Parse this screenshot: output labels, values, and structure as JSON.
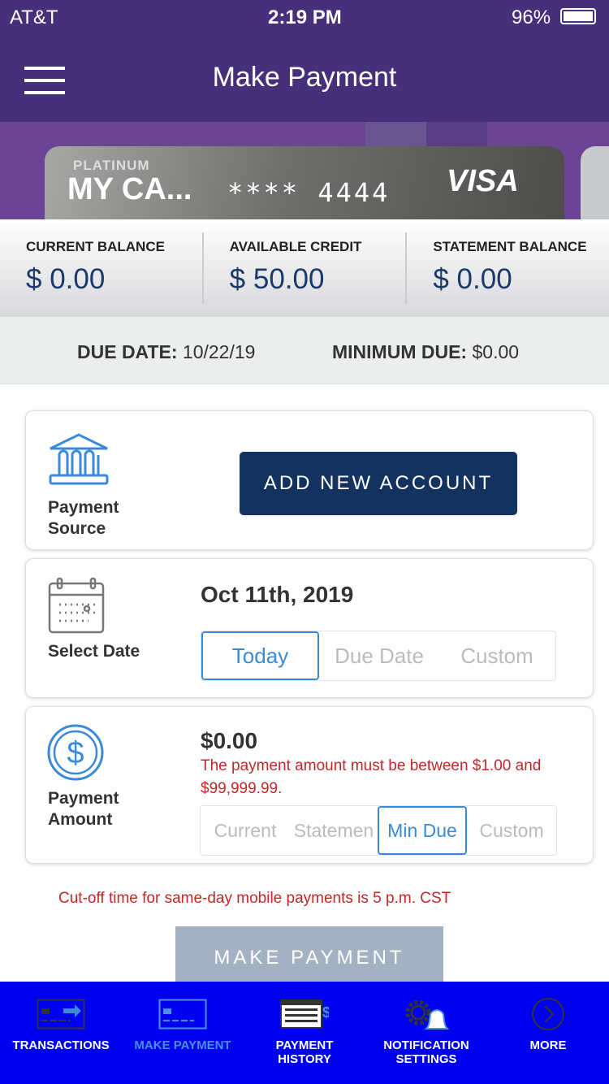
{
  "status": {
    "carrier": "AT&T",
    "time": "2:19 PM",
    "battery": "96%"
  },
  "header": {
    "title": "Make Payment",
    "menu_icon": "hamburger-icon"
  },
  "card": {
    "tier": "PLATINUM",
    "name": "MY CA...",
    "number": "**** 4444",
    "network": "VISA"
  },
  "balances": [
    {
      "label": "CURRENT BALANCE",
      "value": "$ 0.00"
    },
    {
      "label": "AVAILABLE CREDIT",
      "value": "$ 50.00"
    },
    {
      "label": "STATEMENT BALANCE",
      "value": "$ 0.00"
    }
  ],
  "due": {
    "date_label": "DUE DATE:",
    "date": "10/22/19",
    "min_label": "MINIMUM DUE:",
    "min": "$0.00"
  },
  "source": {
    "label": "Payment Source",
    "button": "ADD NEW ACCOUNT",
    "icon": "bank-icon"
  },
  "date": {
    "label": "Select Date",
    "value": "Oct 11th, 2019",
    "options": [
      "Today",
      "Due Date",
      "Custom"
    ],
    "selected": "Today",
    "icon": "calendar-icon"
  },
  "amount": {
    "label": "Payment Amount",
    "value": "$0.00",
    "error": "The payment amount must be between $1.00 and $99,999.99.",
    "options": [
      "Current",
      "Statemen",
      "Min Due",
      "Custom"
    ],
    "selected": "Min Due",
    "icon": "dollar-icon"
  },
  "cutoff": "Cut-off time for same-day mobile payments is 5 p.m. CST",
  "make_payment": "MAKE PAYMENT",
  "nav": [
    {
      "label": "TRANSACTIONS"
    },
    {
      "label": "MAKE PAYMENT",
      "active": true
    },
    {
      "label": "PAYMENT HISTORY"
    },
    {
      "label": "NOTIFICATION SETTINGS"
    },
    {
      "label": "MORE"
    }
  ],
  "colors": {
    "header": "#47307a",
    "nav": "#0000f0",
    "accent": "#3b8ad9",
    "button": "#14325f",
    "error": "#c32727"
  }
}
